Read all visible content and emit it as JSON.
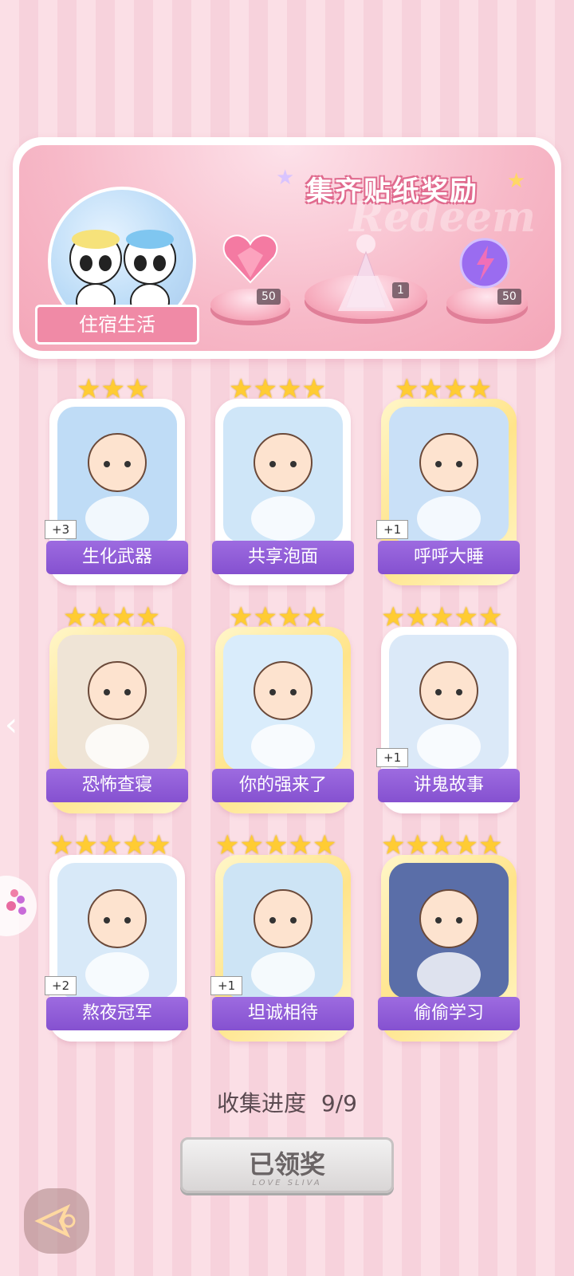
{
  "banner": {
    "title": "集齐贴纸奖励",
    "watermark": "Redeem",
    "dorm_label": "住宿生活",
    "rewards": [
      {
        "icon": "pink-heart-gem-icon",
        "count": "50"
      },
      {
        "icon": "dress-outfit-icon",
        "count": "1"
      },
      {
        "icon": "purple-energy-orb-icon",
        "count": "50"
      }
    ]
  },
  "cards": [
    {
      "name": "生化武器",
      "stars": 3,
      "plus": "+3",
      "gold": false
    },
    {
      "name": "共享泡面",
      "stars": 4,
      "plus": "",
      "gold": false
    },
    {
      "name": "呼呼大睡",
      "stars": 4,
      "plus": "+1",
      "gold": true
    },
    {
      "name": "恐怖查寝",
      "stars": 4,
      "plus": "",
      "gold": true
    },
    {
      "name": "你的强来了",
      "stars": 4,
      "plus": "",
      "gold": true
    },
    {
      "name": "讲鬼故事",
      "stars": 5,
      "plus": "+1",
      "gold": false
    },
    {
      "name": "熬夜冠军",
      "stars": 5,
      "plus": "+2",
      "gold": false
    },
    {
      "name": "坦诚相待",
      "stars": 5,
      "plus": "+1",
      "gold": true
    },
    {
      "name": "偷偷学习",
      "stars": 5,
      "plus": "",
      "gold": true
    }
  ],
  "progress": {
    "label": "收集进度",
    "value": "9/9"
  },
  "claim_button": {
    "label": "已领奖",
    "sub": "LOVE SLIVA"
  },
  "colors": {
    "nameplate": "#8f5cd8",
    "banner_pink": "#f4a6b8",
    "star": "#ffcc33"
  }
}
